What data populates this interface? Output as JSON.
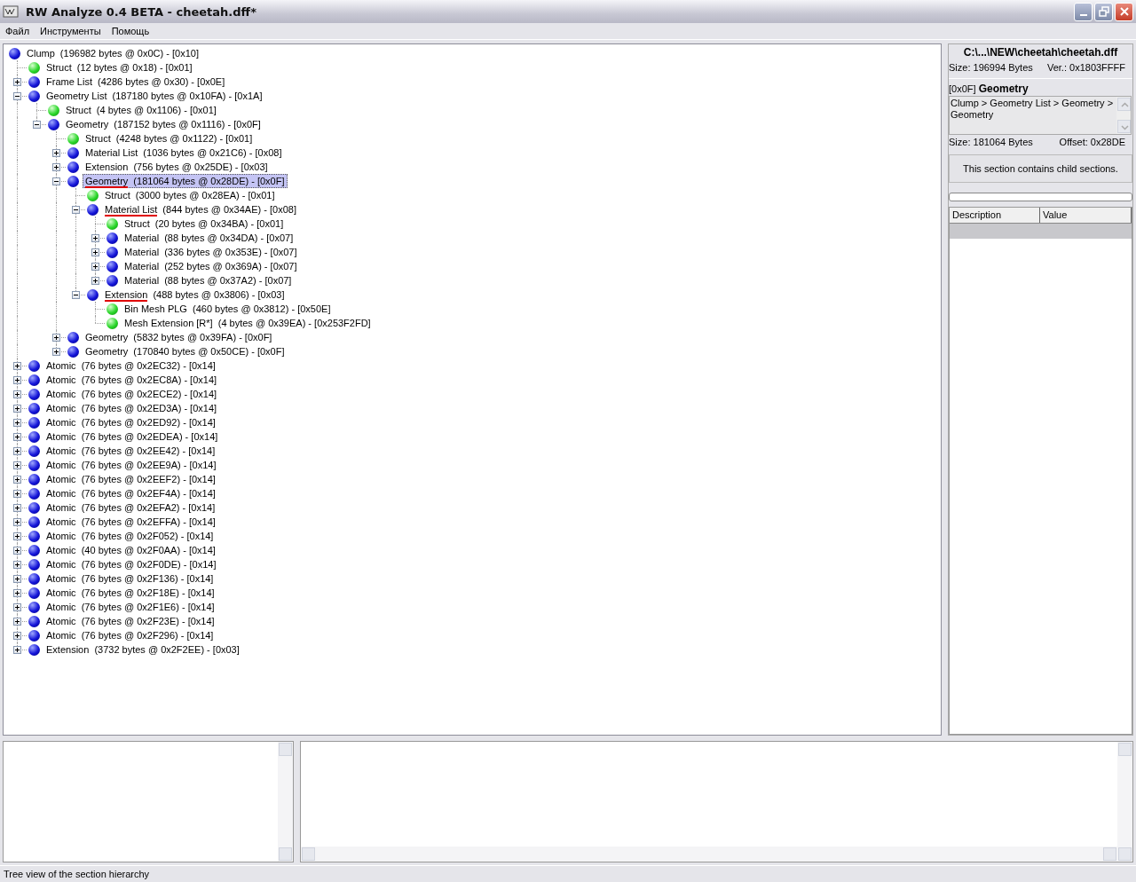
{
  "window": {
    "title": "RW Analyze 0.4 BETA - cheetah.dff*"
  },
  "menu": [
    "Файл",
    "Инструменты",
    "Помощь"
  ],
  "tree": [
    {
      "name": "Clump",
      "info": "(196982 bytes @ 0x0C) - [0x10]",
      "kind": "container",
      "selected": false,
      "marked": false,
      "children": [
        {
          "name": "Struct",
          "info": "(12 bytes @ 0x18) - [0x01]",
          "kind": "leaf",
          "selected": false,
          "marked": false
        },
        {
          "name": "Frame List",
          "info": "(4286 bytes @ 0x30) - [0x0E]",
          "kind": "container",
          "expanded": false,
          "selected": false,
          "marked": false
        },
        {
          "name": "Geometry List",
          "info": "(187180 bytes @ 0x10FA) - [0x1A]",
          "kind": "container",
          "expanded": true,
          "selected": false,
          "marked": false,
          "children": [
            {
              "name": "Struct",
              "info": "(4 bytes @ 0x1106) - [0x01]",
              "kind": "leaf",
              "selected": false,
              "marked": false
            },
            {
              "name": "Geometry",
              "info": "(187152 bytes @ 0x1116) - [0x0F]",
              "kind": "container",
              "expanded": true,
              "selected": false,
              "marked": false,
              "children": [
                {
                  "name": "Struct",
                  "info": "(4248 bytes @ 0x1122) - [0x01]",
                  "kind": "leaf",
                  "selected": false,
                  "marked": false
                },
                {
                  "name": "Material List",
                  "info": "(1036 bytes @ 0x21C6) - [0x08]",
                  "kind": "container",
                  "expanded": false,
                  "selected": false,
                  "marked": false
                },
                {
                  "name": "Extension",
                  "info": "(756 bytes @ 0x25DE) - [0x03]",
                  "kind": "container",
                  "expanded": false,
                  "selected": false,
                  "marked": false
                },
                {
                  "name": "Geometry",
                  "info": "(181064 bytes @ 0x28DE) - [0x0F]",
                  "kind": "container",
                  "expanded": true,
                  "selected": true,
                  "marked": true,
                  "children": [
                    {
                      "name": "Struct",
                      "info": "(3000 bytes @ 0x28EA) - [0x01]",
                      "kind": "leaf",
                      "selected": false,
                      "marked": false
                    },
                    {
                      "name": "Material List",
                      "info": "(844 bytes @ 0x34AE) - [0x08]",
                      "kind": "container",
                      "expanded": true,
                      "selected": false,
                      "marked": true,
                      "children": [
                        {
                          "name": "Struct",
                          "info": "(20 bytes @ 0x34BA) - [0x01]",
                          "kind": "leaf",
                          "selected": false,
                          "marked": false
                        },
                        {
                          "name": "Material",
                          "info": "(88 bytes @ 0x34DA) - [0x07]",
                          "kind": "container",
                          "expanded": false,
                          "selected": false,
                          "marked": false
                        },
                        {
                          "name": "Material",
                          "info": "(336 bytes @ 0x353E) - [0x07]",
                          "kind": "container",
                          "expanded": false,
                          "selected": false,
                          "marked": false
                        },
                        {
                          "name": "Material",
                          "info": "(252 bytes @ 0x369A) - [0x07]",
                          "kind": "container",
                          "expanded": false,
                          "selected": false,
                          "marked": false
                        },
                        {
                          "name": "Material",
                          "info": "(88 bytes @ 0x37A2) - [0x07]",
                          "kind": "container",
                          "expanded": false,
                          "selected": false,
                          "marked": false
                        }
                      ]
                    },
                    {
                      "name": "Extension",
                      "info": "(488 bytes @ 0x3806) - [0x03]",
                      "kind": "container",
                      "expanded": true,
                      "selected": false,
                      "marked": true,
                      "children": [
                        {
                          "name": "Bin Mesh PLG",
                          "info": "(460 bytes @ 0x3812) - [0x50E]",
                          "kind": "leaf",
                          "selected": false,
                          "marked": false
                        },
                        {
                          "name": "Mesh Extension [R*]",
                          "info": "(4 bytes @ 0x39EA) - [0x253F2FD]",
                          "kind": "leaf",
                          "selected": false,
                          "marked": false
                        }
                      ]
                    }
                  ]
                },
                {
                  "name": "Geometry",
                  "info": "(5832 bytes @ 0x39FA) - [0x0F]",
                  "kind": "container",
                  "expanded": false,
                  "selected": false,
                  "marked": false
                },
                {
                  "name": "Geometry",
                  "info": "(170840 bytes @ 0x50CE) - [0x0F]",
                  "kind": "container",
                  "expanded": false,
                  "selected": false,
                  "marked": false
                }
              ]
            }
          ]
        },
        {
          "name": "Atomic",
          "info": "(76 bytes @ 0x2EC32) - [0x14]",
          "kind": "container",
          "expanded": false,
          "selected": false,
          "marked": false
        },
        {
          "name": "Atomic",
          "info": "(76 bytes @ 0x2EC8A) - [0x14]",
          "kind": "container",
          "expanded": false,
          "selected": false,
          "marked": false
        },
        {
          "name": "Atomic",
          "info": "(76 bytes @ 0x2ECE2) - [0x14]",
          "kind": "container",
          "expanded": false,
          "selected": false,
          "marked": false
        },
        {
          "name": "Atomic",
          "info": "(76 bytes @ 0x2ED3A) - [0x14]",
          "kind": "container",
          "expanded": false,
          "selected": false,
          "marked": false
        },
        {
          "name": "Atomic",
          "info": "(76 bytes @ 0x2ED92) - [0x14]",
          "kind": "container",
          "expanded": false,
          "selected": false,
          "marked": false
        },
        {
          "name": "Atomic",
          "info": "(76 bytes @ 0x2EDEA) - [0x14]",
          "kind": "container",
          "expanded": false,
          "selected": false,
          "marked": false
        },
        {
          "name": "Atomic",
          "info": "(76 bytes @ 0x2EE42) - [0x14]",
          "kind": "container",
          "expanded": false,
          "selected": false,
          "marked": false
        },
        {
          "name": "Atomic",
          "info": "(76 bytes @ 0x2EE9A) - [0x14]",
          "kind": "container",
          "expanded": false,
          "selected": false,
          "marked": false
        },
        {
          "name": "Atomic",
          "info": "(76 bytes @ 0x2EEF2) - [0x14]",
          "kind": "container",
          "expanded": false,
          "selected": false,
          "marked": false
        },
        {
          "name": "Atomic",
          "info": "(76 bytes @ 0x2EF4A) - [0x14]",
          "kind": "container",
          "expanded": false,
          "selected": false,
          "marked": false
        },
        {
          "name": "Atomic",
          "info": "(76 bytes @ 0x2EFA2) - [0x14]",
          "kind": "container",
          "expanded": false,
          "selected": false,
          "marked": false
        },
        {
          "name": "Atomic",
          "info": "(76 bytes @ 0x2EFFA) - [0x14]",
          "kind": "container",
          "expanded": false,
          "selected": false,
          "marked": false
        },
        {
          "name": "Atomic",
          "info": "(76 bytes @ 0x2F052) - [0x14]",
          "kind": "container",
          "expanded": false,
          "selected": false,
          "marked": false
        },
        {
          "name": "Atomic",
          "info": "(40 bytes @ 0x2F0AA) - [0x14]",
          "kind": "container",
          "expanded": false,
          "selected": false,
          "marked": false
        },
        {
          "name": "Atomic",
          "info": "(76 bytes @ 0x2F0DE) - [0x14]",
          "kind": "container",
          "expanded": false,
          "selected": false,
          "marked": false
        },
        {
          "name": "Atomic",
          "info": "(76 bytes @ 0x2F136) - [0x14]",
          "kind": "container",
          "expanded": false,
          "selected": false,
          "marked": false
        },
        {
          "name": "Atomic",
          "info": "(76 bytes @ 0x2F18E) - [0x14]",
          "kind": "container",
          "expanded": false,
          "selected": false,
          "marked": false
        },
        {
          "name": "Atomic",
          "info": "(76 bytes @ 0x2F1E6) - [0x14]",
          "kind": "container",
          "expanded": false,
          "selected": false,
          "marked": false
        },
        {
          "name": "Atomic",
          "info": "(76 bytes @ 0x2F23E) - [0x14]",
          "kind": "container",
          "expanded": false,
          "selected": false,
          "marked": false
        },
        {
          "name": "Atomic",
          "info": "(76 bytes @ 0x2F296) - [0x14]",
          "kind": "container",
          "expanded": false,
          "selected": false,
          "marked": false
        },
        {
          "name": "Extension",
          "info": "(3732 bytes @ 0x2F2EE) - [0x03]",
          "kind": "container",
          "expanded": false,
          "selected": false,
          "marked": false
        }
      ]
    }
  ],
  "info_panel": {
    "file_path": "C:\\...\\NEW\\cheetah\\cheetah.dff",
    "file_size": "Size: 196994 Bytes",
    "version": "Ver.: 0x1803FFFF",
    "section_code": "[0x0F]",
    "section_name": "Geometry",
    "breadcrumb": "Clump > Geometry List > Geometry > Geometry",
    "section_size": "Size: 181064 Bytes",
    "section_offset": "Offset: 0x28DE",
    "message": "This section contains child sections.",
    "table": {
      "columns": [
        "Description",
        "Value"
      ]
    }
  },
  "status_bar": "Tree view of the section hierarchy"
}
